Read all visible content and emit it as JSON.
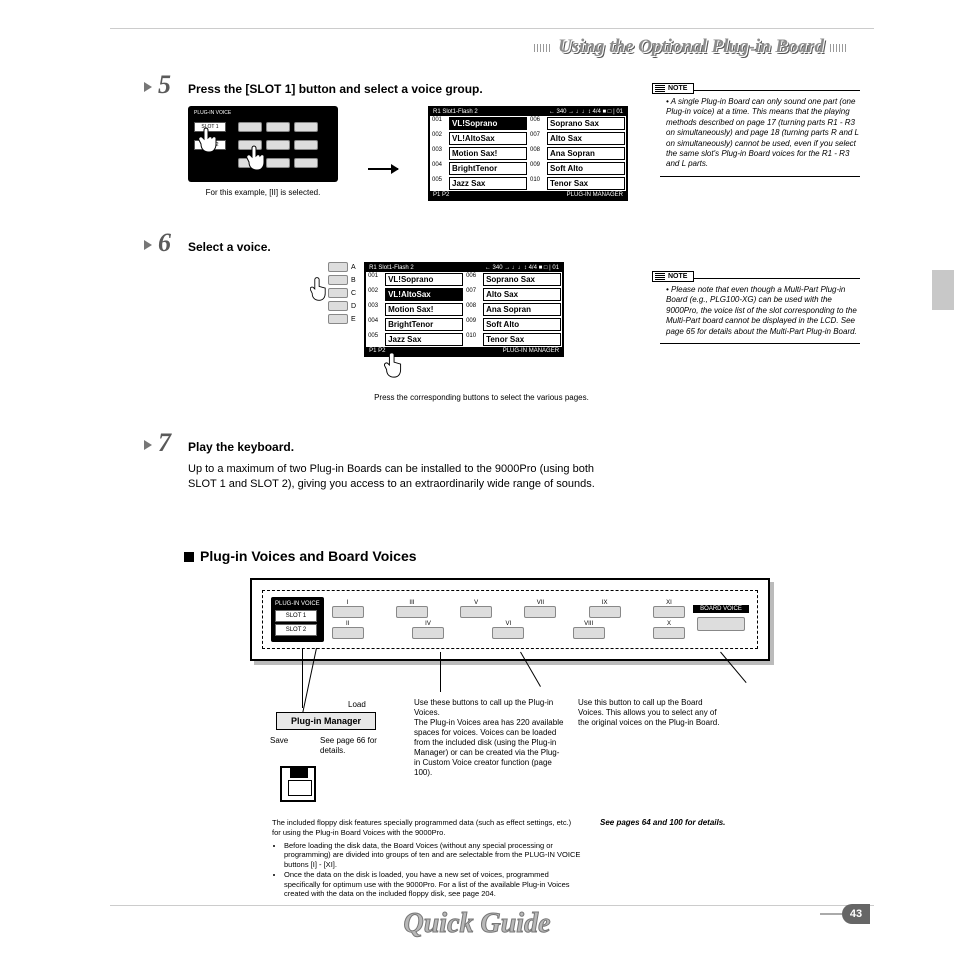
{
  "section_title": "Using the Optional Plug-in Board",
  "page_number": "43",
  "footer_title": "Quick Guide",
  "steps": {
    "s5": {
      "num": "5",
      "title": "Press the [SLOT 1] button and select a voice group.",
      "caption": "For this example, [II] is selected.",
      "panel_header": "PLUG-IN VOICE",
      "slot1": "SLOT 1",
      "slot2": "SLOT 2"
    },
    "s6": {
      "num": "6",
      "title": "Select a voice.",
      "caption": "Press the corresponding buttons to select the various pages.",
      "labels": [
        "A",
        "B",
        "C",
        "D",
        "E"
      ]
    },
    "s7": {
      "num": "7",
      "title": "Play the keyboard.",
      "body": "Up to a maximum of two Plug-in Boards can be installed to the 9000Pro (using both SLOT 1 and SLOT 2), giving you access to an extraordinarily wide range of sounds."
    }
  },
  "lcd": {
    "header_left": "R1   Slot1-Flash 2",
    "header_right": "← 340 →  ♩♩↕ 4/4 ■ □ | 01",
    "footer_left": "P1 P2",
    "footer_right": "PLUG-IN MANAGER",
    "left_nums": [
      "001",
      "002",
      "003",
      "004",
      "005"
    ],
    "right_nums": [
      "006",
      "007",
      "008",
      "009",
      "010"
    ],
    "left": [
      "VL!Soprano",
      "VL!AltoSax",
      "Motion Sax!",
      "BrightTenor",
      "Jazz Sax"
    ],
    "right": [
      "Soprano Sax",
      "Alto Sax",
      "Ana Sopran",
      "Soft Alto",
      "Tenor Sax"
    ]
  },
  "notes": {
    "label": "NOTE",
    "n1": "A single Plug-in Board can only sound one part (one Plug-in voice) at a time. This means that the playing methods described on page 17 (turning parts R1 - R3 on simultaneously) and page 18 (turning parts R and L on simultaneously) cannot be used, even if you select the same slot's Plug-in Board voices for the R1 - R3 and L parts.",
    "n2": "Please note that even though a Multi-Part Plug-in Board (e.g., PLG100-XG) can be used with the 9000Pro, the voice list of the slot corresponding to the Multi-Part board cannot be displayed in the LCD. See page 65 for details about the Multi-Part Plug-in Board."
  },
  "sub_heading": "Plug-in Voices and Board Voices",
  "board": {
    "header": "PLUG-IN VOICE",
    "slot1": "SLOT 1",
    "slot2": "SLOT 2",
    "top_roman": [
      "I",
      "III",
      "V",
      "VII",
      "IX",
      "XI"
    ],
    "bot_roman": [
      "II",
      "IV",
      "VI",
      "VIII",
      "X"
    ],
    "board_voice": "BOARD VOICE"
  },
  "callouts": {
    "load": "Load",
    "save": "Save",
    "plugin_mgr": "Plug-in Manager",
    "see66": "See page 66 for details.",
    "mid": "Use these buttons to call up the Plug-in Voices.\nThe Plug-in Voices area has 220 available spaces for voices. Voices can be loaded from the included disk (using the Plug-in Manager) or can be created via the Plug-in Custom Voice creator function (page 100).",
    "right": "Use this button to call up the Board Voices. This allows you to select any of the original voices on the Plug-in Board."
  },
  "bottom_text": {
    "intro": "The included floppy disk features specially programmed data (such as effect settings, etc.) for using the Plug-in Board Voices with the 9000Pro.",
    "b1": "Before loading the disk data, the Board Voices (without any special processing or programming) are divided into groups of ten and are selectable from the PLUG-IN VOICE buttons [I] - [XI].",
    "b2": "Once the data on the disk is loaded, you have a new set of voices, programmed specifically for optimum use with the 9000Pro. For a list of the available Plug-in Voices created with the data on the included floppy disk, see page 204."
  },
  "bottom_ref": "See pages 64 and 100 for details."
}
